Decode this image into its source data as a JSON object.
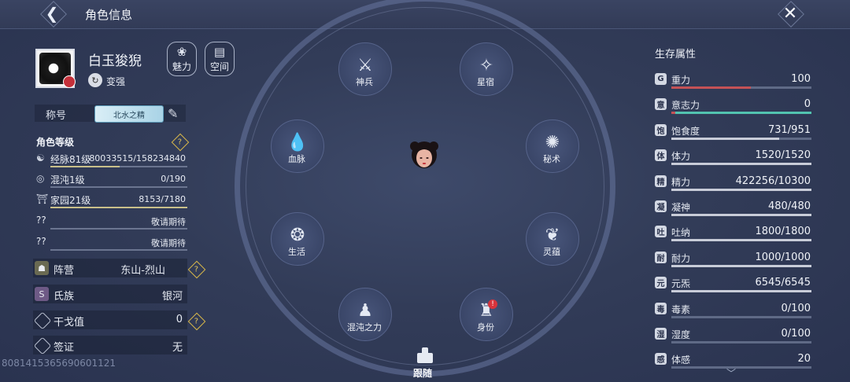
{
  "header": {
    "title": "角色信息"
  },
  "profile": {
    "name": "白玉狻猊",
    "rank_label": "变强"
  },
  "top_buttons": [
    {
      "label": "魅力"
    },
    {
      "label": "空间"
    }
  ],
  "title_row": {
    "label": "称号",
    "badge_text": "北水之精"
  },
  "levels": {
    "title": "角色等级",
    "items": [
      {
        "name": "经脉81级",
        "value": "80033515/158234840",
        "progress": 0.506
      },
      {
        "name": "混沌1级",
        "value": "0/190",
        "progress": 0.0
      },
      {
        "name": "家园21级",
        "value": "8153/7180",
        "progress": 1.0
      },
      {
        "name": "??",
        "value": "敬请期待",
        "progress": 0.0
      },
      {
        "name": "??",
        "value": "敬请期待",
        "progress": 0.0
      }
    ]
  },
  "info": [
    {
      "name": "阵营",
      "value": "东山-烈山"
    },
    {
      "name": "氏族",
      "value": "银河"
    },
    {
      "name": "干戈值",
      "value": "0"
    },
    {
      "name": "签证",
      "value": "无"
    }
  ],
  "uid": "8081415365690601121",
  "wheel": [
    {
      "label": "神兵",
      "icon": "weapon-icon",
      "symbol": "⚔"
    },
    {
      "label": "星宿",
      "icon": "constellation-icon",
      "symbol": "✧"
    },
    {
      "label": "血脉",
      "icon": "blood-drop-icon",
      "symbol": "💧"
    },
    {
      "label": "秘术",
      "icon": "secret-art-icon",
      "symbol": "✺"
    },
    {
      "label": "生活",
      "icon": "life-icon",
      "symbol": "❂"
    },
    {
      "label": "灵蕴",
      "icon": "leaf-icon",
      "symbol": "❦"
    },
    {
      "label": "混沌之力",
      "icon": "chaos-figure-icon",
      "symbol": "♟"
    },
    {
      "label": "身份",
      "icon": "identity-icon",
      "symbol": "♜"
    }
  ],
  "identity_alert": "!",
  "follow": {
    "label": "跟随"
  },
  "stats": {
    "title": "生存属性",
    "items": [
      {
        "icon": "G",
        "name": "重力",
        "value": "100",
        "fill": 0.57,
        "color": "#c45256"
      },
      {
        "icon": "意",
        "name": "意志力",
        "value": "0",
        "fill": 0.0,
        "color": "#52c3b0"
      },
      {
        "icon": "饱",
        "name": "饱食度",
        "value": "731/951",
        "fill": 0.77,
        "color": "#c8ccd8"
      },
      {
        "icon": "体",
        "name": "体力",
        "value": "1520/1520",
        "fill": 1.0,
        "color": "#c8ccd8"
      },
      {
        "icon": "精",
        "name": "精力",
        "value": "422256/10300",
        "fill": 1.0,
        "color": "#c8ccd8"
      },
      {
        "icon": "凝",
        "name": "凝神",
        "value": "480/480",
        "fill": 1.0,
        "color": "#c8ccd8"
      },
      {
        "icon": "吐",
        "name": "吐纳",
        "value": "1800/1800",
        "fill": 1.0,
        "color": "#c8ccd8"
      },
      {
        "icon": "耐",
        "name": "耐力",
        "value": "1000/1000",
        "fill": 1.0,
        "color": "#c8ccd8"
      },
      {
        "icon": "元",
        "name": "元炁",
        "value": "6545/6545",
        "fill": 1.0,
        "color": "#c8ccd8"
      },
      {
        "icon": "毒",
        "name": "毒素",
        "value": "0/100",
        "fill": 0.0,
        "color": "#c8ccd8"
      },
      {
        "icon": "湿",
        "name": "湿度",
        "value": "0/100",
        "fill": 0.0,
        "color": "#c8ccd8"
      },
      {
        "icon": "感",
        "name": "体感",
        "value": "20",
        "fill": 0.0,
        "color": "#c8ccd8"
      }
    ]
  }
}
